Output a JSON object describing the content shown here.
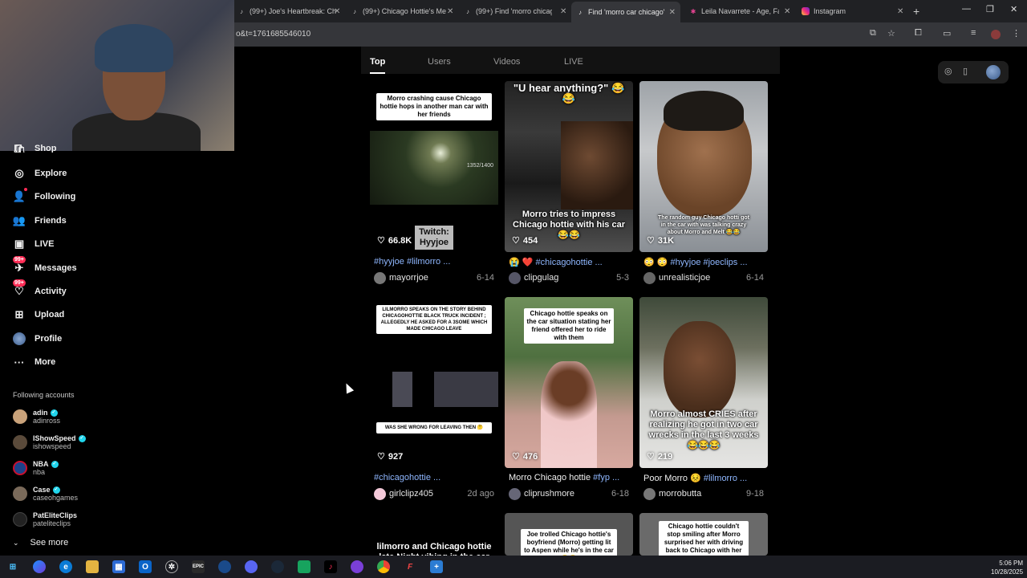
{
  "browser": {
    "tabs": [
      {
        "title": "(99+) Joe's Heartbreak: Ch",
        "icon": "tiktok-icon"
      },
      {
        "title": "(99+) Chicago Hottie's Me",
        "icon": "tiktok-icon"
      },
      {
        "title": "(99+) Find 'morro chicago",
        "icon": "tiktok-icon"
      },
      {
        "title": "Find 'morro car chicago' o",
        "icon": "tiktok-icon",
        "active": true
      },
      {
        "title": "Leila Navarrete - Age, Fam",
        "icon": "site-icon"
      },
      {
        "title": "Instagram",
        "icon": "instagram-icon"
      }
    ],
    "new_tab": "+",
    "url": "o&t=1761685546010",
    "window_controls": {
      "minimize": "—",
      "restore": "❐",
      "close": "✕"
    }
  },
  "sidebar": {
    "partial_item": "Shop",
    "items": [
      {
        "label": "Explore",
        "icon": "compass-icon"
      },
      {
        "label": "Following",
        "icon": "following-icon",
        "dot": true
      },
      {
        "label": "Friends",
        "icon": "friends-icon"
      },
      {
        "label": "LIVE",
        "icon": "live-icon"
      },
      {
        "label": "Messages",
        "icon": "messages-icon",
        "badge": "99+"
      },
      {
        "label": "Activity",
        "icon": "activity-icon",
        "badge": "99+"
      },
      {
        "label": "Upload",
        "icon": "upload-icon"
      },
      {
        "label": "Profile",
        "icon": "profile-avatar"
      },
      {
        "label": "More",
        "icon": "more-icon"
      }
    ],
    "following_header": "Following accounts",
    "accounts": [
      {
        "name": "adin",
        "handle": "adinross",
        "verified": true
      },
      {
        "name": "IShowSpeed",
        "handle": "ishowspeed",
        "verified": true
      },
      {
        "name": "NBA",
        "handle": "nba",
        "verified": true
      },
      {
        "name": "Case",
        "handle": "caseohgames",
        "verified": true
      },
      {
        "name": "PatEliteClips",
        "handle": "pateliteclips",
        "verified": false
      }
    ],
    "see_more": "See more"
  },
  "search_tabs": [
    "Top",
    "Users",
    "Videos",
    "LIVE"
  ],
  "videos": [
    {
      "caption": "Morro crashing cause Chicago hottie hops in another man car with her friends",
      "overlay": "Twitch: Hyyjoe",
      "watermark": "1352/1400",
      "likes": "66.8K",
      "desc_tags": "#hyyjoe #lilmorro ...",
      "author": "mayorrjoe",
      "date": "6-14"
    },
    {
      "caption": "\"U hear anything?\" 😂😂",
      "overlay": "Morro tries to impress Chicago hottie with his car 😂😂",
      "likes": "454",
      "desc_prefix": "😭 ❤️ ",
      "desc_tags": "#chicagohottie ...",
      "author": "clipgulag",
      "date": "5-3"
    },
    {
      "caption": "The random guy Chicago hotti got in the car with was talking crazy about Morro and Melt 😂😂",
      "likes": "31K",
      "desc_prefix": "😳 😳 ",
      "desc_tags": "#hyyjoe #joeclips ...",
      "author": "unrealisticjoe",
      "date": "6-14"
    },
    {
      "caption": "LILMORRO SPEAKS ON THE STORY BEHIND CHICAGOHOTTIE BLACK TRUCK INCIDENT ; ALLEGEDLY HE ASKED FOR A 3SOME WHICH MADE CHICAGO LEAVE",
      "caption2": "WAS SHE WRONG FOR LEAVING THEN 🤔",
      "likes": "927",
      "desc_tags": "#chicagohottie ...",
      "author": "girlclipz405",
      "date": "2d ago"
    },
    {
      "caption": "Chicago hottie speaks on the car situation stating her friend offered her to ride with them",
      "likes": "476",
      "desc_text": "Morro Chicago hottie ",
      "desc_tags": "#fyp ...",
      "author": "cliprushmore",
      "date": "6-18"
    },
    {
      "overlay": "Morro almost CRIES after realizing he got in two car wrecks in the last 3 weeks 😂😂😂",
      "likes": "219",
      "desc_text": "Poor Morro 😣 ",
      "desc_tags": "#lilmorro ...",
      "author": "morrobutta",
      "date": "9-18"
    },
    {
      "overlay": "lilmorro and Chicago hottie late Night vibing in the car"
    },
    {
      "caption": "Joe trolled Chicago hottie's boyfriend (Morro) getting lit to Aspen while he's in the car 😂😂"
    },
    {
      "caption": "Chicago hottie couldn't stop smiling after Morro surprised her with driving back to Chicago with her"
    }
  ],
  "taskbar": {
    "time": "5:06 PM",
    "date": "10/28/2025"
  }
}
